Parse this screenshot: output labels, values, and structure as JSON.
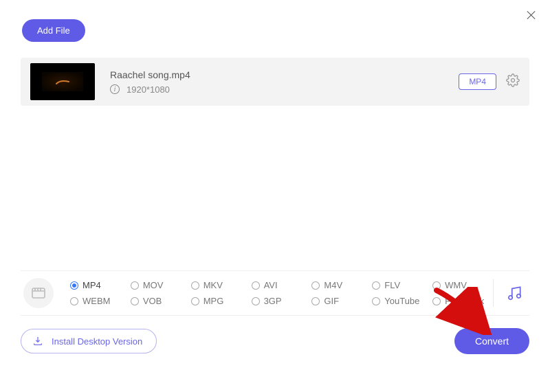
{
  "toolbar": {
    "add_file_label": "Add File"
  },
  "file": {
    "name": "Raachel song.mp4",
    "resolution": "1920*1080",
    "format_badge": "MP4"
  },
  "formats": {
    "selected": "MP4",
    "items": [
      "MP4",
      "MOV",
      "MKV",
      "AVI",
      "M4V",
      "FLV",
      "WMV",
      "WEBM",
      "VOB",
      "MPG",
      "3GP",
      "GIF",
      "YouTube",
      "Facebook"
    ]
  },
  "footer": {
    "install_label": "Install Desktop Version",
    "convert_label": "Convert"
  },
  "colors": {
    "accent": "#5f5be6",
    "arrow": "#d40d0d"
  }
}
